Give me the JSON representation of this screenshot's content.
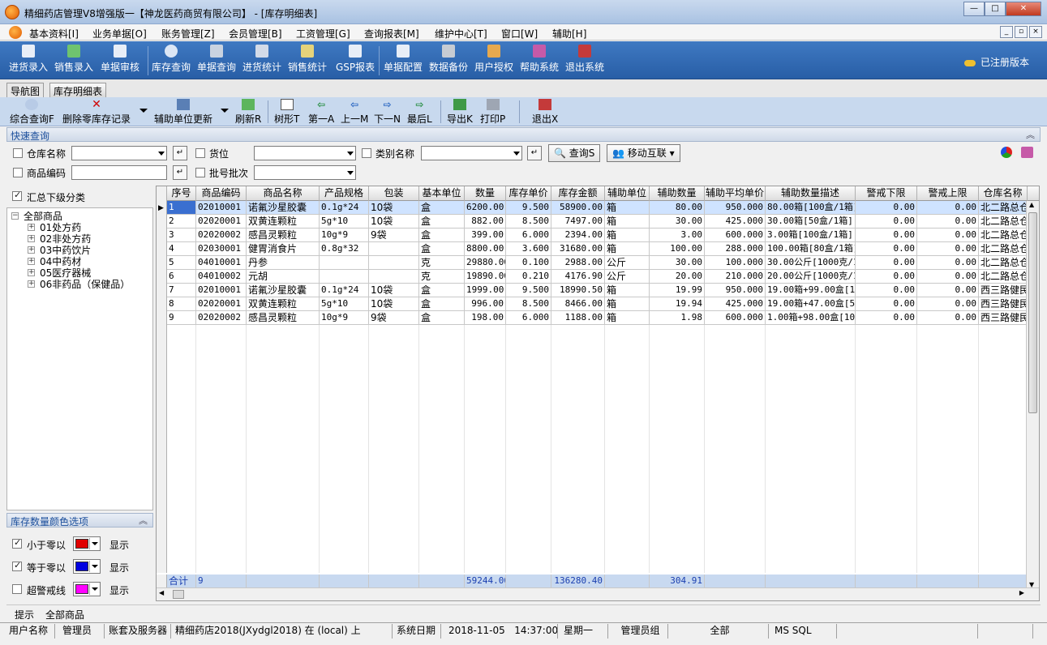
{
  "window": {
    "title": "精细药店管理V8增强版一【神龙医药商贸有限公司】 - [库存明细表]",
    "buttons": {
      "minimize": "—",
      "maximize": "□",
      "close": "✕"
    }
  },
  "menu": {
    "items": [
      "基本资料[I]",
      "业务单据[O]",
      "账务管理[Z]",
      "会员管理[B]",
      "工资管理[G]",
      "查询报表[M]",
      "维护中心[T]",
      "窗口[W]",
      "辅助[H]"
    ],
    "mdi": [
      "_",
      "▫",
      "×"
    ]
  },
  "toolbar": {
    "items": [
      "进货录入",
      "销售录入",
      "单据审核",
      "库存查询",
      "单据查询",
      "进货统计",
      "销售统计",
      "GSP报表",
      "单据配置",
      "数据备份",
      "用户授权",
      "帮助系统",
      "退出系统"
    ],
    "registered": "已注册版本"
  },
  "tabs": [
    "导航图",
    "库存明细表"
  ],
  "subtoolbar": {
    "items": [
      "综合查询F",
      "删除零库存记录",
      "辅助单位更新",
      "刷新R",
      "树形T",
      "第一A",
      "上一M",
      "下一N",
      "最后L",
      "导出K",
      "打印P",
      "退出X"
    ]
  },
  "quick_query": {
    "title": "快速查询",
    "labels": {
      "warehouse": "仓库名称",
      "location": "货位",
      "category": "类别名称",
      "product_code": "商品编码",
      "batch": "批号批次"
    },
    "query_button": "查询S",
    "mobile_button": "移动互联"
  },
  "left": {
    "summary_label": "汇总下级分类",
    "tree": {
      "root": "全部商品",
      "children": [
        "01处方药",
        "02非处方药",
        "03中药饮片",
        "04中药材",
        "05医疗器械",
        "06非药品（保健品）"
      ]
    },
    "color_options": {
      "title": "库存数量颜色选项",
      "rows": [
        {
          "label": "小于零以",
          "color": "#e00000",
          "checked": true,
          "suffix": "显示"
        },
        {
          "label": "等于零以",
          "color": "#0000e0",
          "checked": true,
          "suffix": "显示"
        },
        {
          "label": "超警戒线",
          "color": "#ff00ff",
          "checked": false,
          "suffix": "显示"
        }
      ]
    }
  },
  "grid": {
    "columns": [
      "序号",
      "商品编码",
      "商品名称",
      "产品规格",
      "包装",
      "基本单位",
      "数量",
      "库存单价",
      "库存金额",
      "辅助单位",
      "辅助数量",
      "辅助平均单价",
      "辅助数量描述",
      "警戒下限",
      "警戒上限",
      "仓库名称"
    ],
    "rows": [
      [
        "1",
        "02010001",
        "诺氟沙星胶囊",
        "0.1g*24",
        "10袋",
        "盒",
        "6200.00",
        "9.500",
        "58900.00",
        "箱",
        "80.00",
        "950.000",
        "80.00箱[100盒/1箱]",
        "0.00",
        "0.00",
        "北二路总仓"
      ],
      [
        "2",
        "02020001",
        "双黄连颗粒",
        "5g*10",
        "10袋",
        "盒",
        "882.00",
        "8.500",
        "7497.00",
        "箱",
        "30.00",
        "425.000",
        "30.00箱[50盒/1箱]",
        "0.00",
        "0.00",
        "北二路总仓"
      ],
      [
        "3",
        "02020002",
        "感昌灵颗粒",
        "10g*9",
        "9袋",
        "盒",
        "399.00",
        "6.000",
        "2394.00",
        "箱",
        "3.00",
        "600.000",
        "3.00箱[100盒/1箱]",
        "0.00",
        "0.00",
        "北二路总仓"
      ],
      [
        "4",
        "02030001",
        "健胃消食片",
        "0.8g*32",
        "",
        "盒",
        "8800.00",
        "3.600",
        "31680.00",
        "箱",
        "100.00",
        "288.000",
        "100.00箱[80盒/1箱]",
        "0.00",
        "0.00",
        "北二路总仓"
      ],
      [
        "5",
        "04010001",
        "丹参",
        "",
        "",
        "克",
        "29880.00",
        "0.100",
        "2988.00",
        "公斤",
        "30.00",
        "100.000",
        "30.00公斤[1000克/1",
        "0.00",
        "0.00",
        "北二路总仓"
      ],
      [
        "6",
        "04010002",
        "元胡",
        "",
        "",
        "克",
        "19890.00",
        "0.210",
        "4176.90",
        "公斤",
        "20.00",
        "210.000",
        "20.00公斤[1000克/1",
        "0.00",
        "0.00",
        "北二路总仓"
      ],
      [
        "7",
        "02010001",
        "诺氟沙星胶囊",
        "0.1g*24",
        "10袋",
        "盒",
        "1999.00",
        "9.500",
        "18990.50",
        "箱",
        "19.99",
        "950.000",
        "19.00箱+99.00盒[10",
        "0.00",
        "0.00",
        "西三路健民"
      ],
      [
        "8",
        "02020001",
        "双黄连颗粒",
        "5g*10",
        "10袋",
        "盒",
        "996.00",
        "8.500",
        "8466.00",
        "箱",
        "19.94",
        "425.000",
        "19.00箱+47.00盒[50",
        "0.00",
        "0.00",
        "西三路健民"
      ],
      [
        "9",
        "02020002",
        "感昌灵颗粒",
        "10g*9",
        "9袋",
        "盒",
        "198.00",
        "6.000",
        "1188.00",
        "箱",
        "1.98",
        "600.000",
        "1.00箱+98.00盒[100",
        "0.00",
        "0.00",
        "西三路健民"
      ]
    ],
    "footer": {
      "label": "合计",
      "count": "9",
      "qty": "59244.00",
      "amount": "136280.40",
      "aux_qty": "304.91"
    }
  },
  "tip": {
    "label": "提示",
    "value": "全部商品"
  },
  "status": {
    "user_label": "用户名称",
    "user": "管理员",
    "account_label": "账套及服务器",
    "account": "精细药店2018(JXydgl2018) 在 (local) 上",
    "date_label": "系统日期",
    "date": "2018-11-05",
    "time": "14:37:00",
    "weekday": "星期一",
    "group": "管理员组",
    "scope": "全部",
    "db": "MS SQL"
  },
  "colors": {
    "toolbar_bg": "#2f68b1",
    "grid_selected": "#cfe3ff",
    "footer_bg": "#c8d9f0",
    "footer_text": "#1a3fb0"
  }
}
